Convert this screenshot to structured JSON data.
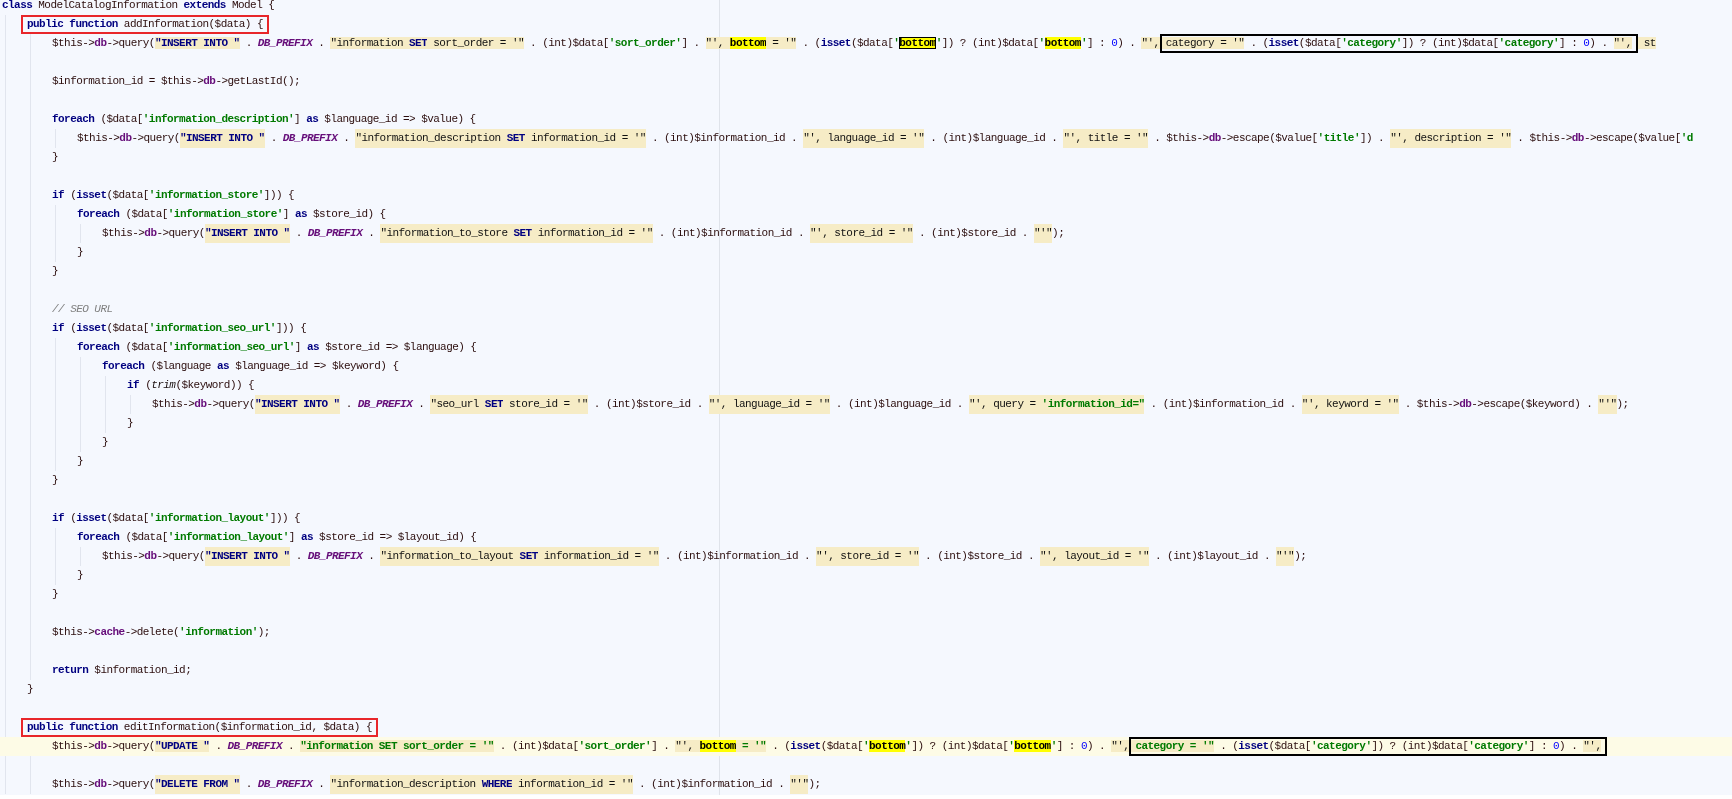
{
  "lines": [
    {
      "kind": "code",
      "current": false,
      "tokens": [
        {
          "kind": "kw",
          "text": "class"
        },
        {
          "kind": "code",
          "text": " ModelCatalogInformation "
        },
        {
          "kind": "kw",
          "text": "extends"
        },
        {
          "kind": "code",
          "text": " Model {"
        }
      ],
      "children": [
        {
          "kind": "code",
          "current": false,
          "tokens": [
            {
              "kind": "frame",
              "color": "#e8262a",
              "tokens": [
                {
                  "kind": "kw",
                  "text": "public function"
                },
                {
                  "kind": "code",
                  "text": " addInformation($data) {"
                }
              ]
            }
          ],
          "children": [
            {
              "kind": "code",
              "current": false,
              "tokens": [
                {
                  "kind": "code",
                  "text": "$this->"
                },
                {
                  "kind": "prop",
                  "text": "db"
                },
                {
                  "kind": "code",
                  "text": "->query("
                },
                {
                  "kind": "sqlkw",
                  "text": "\"INSERT INTO \""
                },
                {
                  "kind": "code",
                  "text": " . "
                },
                {
                  "kind": "const",
                  "text": "DB_PREFIX"
                },
                {
                  "kind": "code",
                  "text": " . "
                },
                {
                  "kind": "str",
                  "text": "\"information "
                },
                {
                  "kind": "sqlkw",
                  "text": "SET"
                },
                {
                  "kind": "str",
                  "text": " sort_order = '\""
                },
                {
                  "kind": "code",
                  "text": " . (int)$data["
                },
                {
                  "kind": "key",
                  "text": "'sort_order'"
                },
                {
                  "kind": "code",
                  "text": "] . "
                },
                {
                  "kind": "str",
                  "text": "\"', "
                },
                {
                  "kind": "mark",
                  "text": "bottom"
                },
                {
                  "kind": "str",
                  "text": " = '\""
                },
                {
                  "kind": "code",
                  "text": " . ("
                },
                {
                  "kind": "kw",
                  "text": "isset"
                },
                {
                  "kind": "code",
                  "text": "($data["
                },
                {
                  "kind": "key",
                  "text": "'"
                },
                {
                  "kind": "markcaret",
                  "text": "bottom"
                },
                {
                  "kind": "key",
                  "text": "'"
                },
                {
                  "kind": "code",
                  "text": "]) ? (int)$data["
                },
                {
                  "kind": "key",
                  "text": "'"
                },
                {
                  "kind": "mark",
                  "text": "bottom"
                },
                {
                  "kind": "key",
                  "text": "'"
                },
                {
                  "kind": "code",
                  "text": "] : "
                },
                {
                  "kind": "num",
                  "text": "0"
                },
                {
                  "kind": "code",
                  "text": ") . "
                },
                {
                  "kind": "str",
                  "text": "\"', "
                },
                {
                  "kind": "frame",
                  "color": "#000000",
                  "tokens": [
                    {
                      "kind": "str",
                      "text": "category = '\""
                    },
                    {
                      "kind": "code",
                      "text": " . ("
                    },
                    {
                      "kind": "kw",
                      "text": "isset"
                    },
                    {
                      "kind": "code",
                      "text": "($data["
                    },
                    {
                      "kind": "key",
                      "text": "'category'"
                    },
                    {
                      "kind": "code",
                      "text": "]) ? (int)$data["
                    },
                    {
                      "kind": "key",
                      "text": "'category'"
                    },
                    {
                      "kind": "code",
                      "text": "] : "
                    },
                    {
                      "kind": "num",
                      "text": "0"
                    },
                    {
                      "kind": "code",
                      "text": ") . "
                    },
                    {
                      "kind": "str",
                      "text": "\"',"
                    }
                  ]
                },
                {
                  "kind": "str",
                  "text": " st"
                }
              ]
            },
            {
              "kind": "blank",
              "current": false
            },
            {
              "kind": "code",
              "current": false,
              "tokens": [
                {
                  "kind": "code",
                  "text": "$information_id = $this->"
                },
                {
                  "kind": "prop",
                  "text": "db"
                },
                {
                  "kind": "code",
                  "text": "->getLastId();"
                }
              ]
            },
            {
              "kind": "blank",
              "current": false
            },
            {
              "kind": "code",
              "current": false,
              "tokens": [
                {
                  "kind": "kw",
                  "text": "foreach"
                },
                {
                  "kind": "code",
                  "text": " ($data["
                },
                {
                  "kind": "key",
                  "text": "'information_description'"
                },
                {
                  "kind": "code",
                  "text": "] "
                },
                {
                  "kind": "kw",
                  "text": "as"
                },
                {
                  "kind": "code",
                  "text": " $language_id => $value) {"
                }
              ],
              "children": [
                {
                  "kind": "code",
                  "current": false,
                  "tokens": [
                    {
                      "kind": "code",
                      "text": "$this->"
                    },
                    {
                      "kind": "prop",
                      "text": "db"
                    },
                    {
                      "kind": "code",
                      "text": "->query("
                    },
                    {
                      "kind": "sqlkw",
                      "text": "\"INSERT INTO \""
                    },
                    {
                      "kind": "code",
                      "text": " . "
                    },
                    {
                      "kind": "const",
                      "text": "DB_PREFIX"
                    },
                    {
                      "kind": "code",
                      "text": " . "
                    },
                    {
                      "kind": "str",
                      "text": "\"information_description "
                    },
                    {
                      "kind": "sqlkw",
                      "text": "SET"
                    },
                    {
                      "kind": "str",
                      "text": " information_id = '\""
                    },
                    {
                      "kind": "code",
                      "text": " . (int)$information_id . "
                    },
                    {
                      "kind": "str",
                      "text": "\"', language_id = '\""
                    },
                    {
                      "kind": "code",
                      "text": " . (int)$language_id . "
                    },
                    {
                      "kind": "str",
                      "text": "\"', title = '\""
                    },
                    {
                      "kind": "code",
                      "text": " . $this->"
                    },
                    {
                      "kind": "prop",
                      "text": "db"
                    },
                    {
                      "kind": "code",
                      "text": "->escape($value["
                    },
                    {
                      "kind": "key",
                      "text": "'title'"
                    },
                    {
                      "kind": "code",
                      "text": "]) . "
                    },
                    {
                      "kind": "str",
                      "text": "\"', description = '\""
                    },
                    {
                      "kind": "code",
                      "text": " . $this->"
                    },
                    {
                      "kind": "prop",
                      "text": "db"
                    },
                    {
                      "kind": "code",
                      "text": "->escape($value["
                    },
                    {
                      "kind": "key",
                      "text": "'d"
                    }
                  ]
                }
              ]
            },
            {
              "kind": "code",
              "current": false,
              "tokens": [
                {
                  "kind": "code",
                  "text": "}"
                }
              ]
            },
            {
              "kind": "blank",
              "current": false
            },
            {
              "kind": "code",
              "current": false,
              "tokens": [
                {
                  "kind": "kw",
                  "text": "if"
                },
                {
                  "kind": "code",
                  "text": " ("
                },
                {
                  "kind": "kw",
                  "text": "isset"
                },
                {
                  "kind": "code",
                  "text": "($data["
                },
                {
                  "kind": "key",
                  "text": "'information_store'"
                },
                {
                  "kind": "code",
                  "text": "])) {"
                }
              ],
              "children": [
                {
                  "kind": "code",
                  "current": false,
                  "tokens": [
                    {
                      "kind": "kw",
                      "text": "foreach"
                    },
                    {
                      "kind": "code",
                      "text": " ($data["
                    },
                    {
                      "kind": "key",
                      "text": "'information_store'"
                    },
                    {
                      "kind": "code",
                      "text": "] "
                    },
                    {
                      "kind": "kw",
                      "text": "as"
                    },
                    {
                      "kind": "code",
                      "text": " $store_id) {"
                    }
                  ],
                  "children": [
                    {
                      "kind": "code",
                      "current": false,
                      "tokens": [
                        {
                          "kind": "code",
                          "text": "$this->"
                        },
                        {
                          "kind": "prop",
                          "text": "db"
                        },
                        {
                          "kind": "code",
                          "text": "->query("
                        },
                        {
                          "kind": "sqlkw",
                          "text": "\"INSERT INTO \""
                        },
                        {
                          "kind": "code",
                          "text": " . "
                        },
                        {
                          "kind": "const",
                          "text": "DB_PREFIX"
                        },
                        {
                          "kind": "code",
                          "text": " . "
                        },
                        {
                          "kind": "str",
                          "text": "\"information_to_store "
                        },
                        {
                          "kind": "sqlkw",
                          "text": "SET"
                        },
                        {
                          "kind": "str",
                          "text": " information_id = '\""
                        },
                        {
                          "kind": "code",
                          "text": " . (int)$information_id . "
                        },
                        {
                          "kind": "str",
                          "text": "\"', store_id = '\""
                        },
                        {
                          "kind": "code",
                          "text": " . (int)$store_id . "
                        },
                        {
                          "kind": "str",
                          "text": "\"'\""
                        },
                        {
                          "kind": "code",
                          "text": ");"
                        }
                      ]
                    }
                  ]
                },
                {
                  "kind": "code",
                  "current": false,
                  "tokens": [
                    {
                      "kind": "code",
                      "text": "}"
                    }
                  ]
                }
              ]
            },
            {
              "kind": "code",
              "current": false,
              "tokens": [
                {
                  "kind": "code",
                  "text": "}"
                }
              ]
            },
            {
              "kind": "blank",
              "current": false
            },
            {
              "kind": "code",
              "current": false,
              "tokens": [
                {
                  "kind": "comment",
                  "text": "// SEO URL"
                }
              ]
            },
            {
              "kind": "code",
              "current": false,
              "tokens": [
                {
                  "kind": "kw",
                  "text": "if"
                },
                {
                  "kind": "code",
                  "text": " ("
                },
                {
                  "kind": "kw",
                  "text": "isset"
                },
                {
                  "kind": "code",
                  "text": "($data["
                },
                {
                  "kind": "key",
                  "text": "'information_seo_url'"
                },
                {
                  "kind": "code",
                  "text": "])) {"
                }
              ],
              "children": [
                {
                  "kind": "code",
                  "current": false,
                  "tokens": [
                    {
                      "kind": "kw",
                      "text": "foreach"
                    },
                    {
                      "kind": "code",
                      "text": " ($data["
                    },
                    {
                      "kind": "key",
                      "text": "'information_seo_url'"
                    },
                    {
                      "kind": "code",
                      "text": "] "
                    },
                    {
                      "kind": "kw",
                      "text": "as"
                    },
                    {
                      "kind": "code",
                      "text": " $store_id => $language) {"
                    }
                  ],
                  "children": [
                    {
                      "kind": "code",
                      "current": false,
                      "tokens": [
                        {
                          "kind": "kw",
                          "text": "foreach"
                        },
                        {
                          "kind": "code",
                          "text": " ($language "
                        },
                        {
                          "kind": "kw",
                          "text": "as"
                        },
                        {
                          "kind": "code",
                          "text": " $language_id => $keyword) {"
                        }
                      ],
                      "children": [
                        {
                          "kind": "code",
                          "current": false,
                          "tokens": [
                            {
                              "kind": "kw",
                              "text": "if"
                            },
                            {
                              "kind": "code",
                              "text": " ("
                            },
                            {
                              "kind": "fn",
                              "text": "trim"
                            },
                            {
                              "kind": "code",
                              "text": "($keyword)) {"
                            }
                          ],
                          "children": [
                            {
                              "kind": "code",
                              "current": false,
                              "tokens": [
                                {
                                  "kind": "code",
                                  "text": "$this->"
                                },
                                {
                                  "kind": "prop",
                                  "text": "db"
                                },
                                {
                                  "kind": "code",
                                  "text": "->query("
                                },
                                {
                                  "kind": "sqlkw",
                                  "text": "\"INSERT INTO \""
                                },
                                {
                                  "kind": "code",
                                  "text": " . "
                                },
                                {
                                  "kind": "const",
                                  "text": "DB_PREFIX"
                                },
                                {
                                  "kind": "code",
                                  "text": " . "
                                },
                                {
                                  "kind": "str",
                                  "text": "\"seo_url "
                                },
                                {
                                  "kind": "sqlkw",
                                  "text": "SET"
                                },
                                {
                                  "kind": "str",
                                  "text": " store_id = '\""
                                },
                                {
                                  "kind": "code",
                                  "text": " . (int)$store_id . "
                                },
                                {
                                  "kind": "str",
                                  "text": "\"', language_id = '\""
                                },
                                {
                                  "kind": "code",
                                  "text": " . (int)$language_id . "
                                },
                                {
                                  "kind": "str",
                                  "text": "\"', query = "
                                },
                                {
                                  "kind": "sqlstr",
                                  "text": "'information_id=\""
                                },
                                {
                                  "kind": "code",
                                  "text": " . (int)$information_id . "
                                },
                                {
                                  "kind": "str",
                                  "text": "\"', keyword = '\""
                                },
                                {
                                  "kind": "code",
                                  "text": " . $this->"
                                },
                                {
                                  "kind": "prop",
                                  "text": "db"
                                },
                                {
                                  "kind": "code",
                                  "text": "->escape($keyword) . "
                                },
                                {
                                  "kind": "str",
                                  "text": "\"'\""
                                },
                                {
                                  "kind": "code",
                                  "text": ");"
                                }
                              ]
                            }
                          ]
                        },
                        {
                          "kind": "code",
                          "current": false,
                          "tokens": [
                            {
                              "kind": "code",
                              "text": "}"
                            }
                          ]
                        }
                      ]
                    },
                    {
                      "kind": "code",
                      "current": false,
                      "tokens": [
                        {
                          "kind": "code",
                          "text": "}"
                        }
                      ]
                    }
                  ]
                },
                {
                  "kind": "code",
                  "current": false,
                  "tokens": [
                    {
                      "kind": "code",
                      "text": "}"
                    }
                  ]
                }
              ]
            },
            {
              "kind": "code",
              "current": false,
              "tokens": [
                {
                  "kind": "code",
                  "text": "}"
                }
              ]
            },
            {
              "kind": "blank",
              "current": false
            },
            {
              "kind": "code",
              "current": false,
              "tokens": [
                {
                  "kind": "kw",
                  "text": "if"
                },
                {
                  "kind": "code",
                  "text": " ("
                },
                {
                  "kind": "kw",
                  "text": "isset"
                },
                {
                  "kind": "code",
                  "text": "($data["
                },
                {
                  "kind": "key",
                  "text": "'information_layout'"
                },
                {
                  "kind": "code",
                  "text": "])) {"
                }
              ],
              "children": [
                {
                  "kind": "code",
                  "current": false,
                  "tokens": [
                    {
                      "kind": "kw",
                      "text": "foreach"
                    },
                    {
                      "kind": "code",
                      "text": " ($data["
                    },
                    {
                      "kind": "key",
                      "text": "'information_layout'"
                    },
                    {
                      "kind": "code",
                      "text": "] "
                    },
                    {
                      "kind": "kw",
                      "text": "as"
                    },
                    {
                      "kind": "code",
                      "text": " $store_id => $layout_id) {"
                    }
                  ],
                  "children": [
                    {
                      "kind": "code",
                      "current": false,
                      "tokens": [
                        {
                          "kind": "code",
                          "text": "$this->"
                        },
                        {
                          "kind": "prop",
                          "text": "db"
                        },
                        {
                          "kind": "code",
                          "text": "->query("
                        },
                        {
                          "kind": "sqlkw",
                          "text": "\"INSERT INTO \""
                        },
                        {
                          "kind": "code",
                          "text": " . "
                        },
                        {
                          "kind": "const",
                          "text": "DB_PREFIX"
                        },
                        {
                          "kind": "code",
                          "text": " . "
                        },
                        {
                          "kind": "str",
                          "text": "\"information_to_layout "
                        },
                        {
                          "kind": "sqlkw",
                          "text": "SET"
                        },
                        {
                          "kind": "str",
                          "text": " information_id = '\""
                        },
                        {
                          "kind": "code",
                          "text": " . (int)$information_id . "
                        },
                        {
                          "kind": "str",
                          "text": "\"', store_id = '\""
                        },
                        {
                          "kind": "code",
                          "text": " . (int)$store_id . "
                        },
                        {
                          "kind": "str",
                          "text": "\"', layout_id = '\""
                        },
                        {
                          "kind": "code",
                          "text": " . (int)$layout_id . "
                        },
                        {
                          "kind": "str",
                          "text": "\"'\""
                        },
                        {
                          "kind": "code",
                          "text": ");"
                        }
                      ]
                    }
                  ]
                },
                {
                  "kind": "code",
                  "current": false,
                  "tokens": [
                    {
                      "kind": "code",
                      "text": "}"
                    }
                  ]
                }
              ]
            },
            {
              "kind": "code",
              "current": false,
              "tokens": [
                {
                  "kind": "code",
                  "text": "}"
                }
              ]
            },
            {
              "kind": "blank",
              "current": false
            },
            {
              "kind": "code",
              "current": false,
              "tokens": [
                {
                  "kind": "code",
                  "text": "$this->"
                },
                {
                  "kind": "prop",
                  "text": "cache"
                },
                {
                  "kind": "code",
                  "text": "->delete("
                },
                {
                  "kind": "key",
                  "text": "'information'"
                },
                {
                  "kind": "code",
                  "text": ");"
                }
              ]
            },
            {
              "kind": "blank",
              "current": false
            },
            {
              "kind": "code",
              "current": false,
              "tokens": [
                {
                  "kind": "kw",
                  "text": "return"
                },
                {
                  "kind": "code",
                  "text": " $information_id;"
                }
              ]
            }
          ]
        },
        {
          "kind": "code",
          "current": false,
          "tokens": [
            {
              "kind": "code",
              "text": "}"
            }
          ]
        },
        {
          "kind": "blank",
          "current": false
        },
        {
          "kind": "code",
          "current": false,
          "tokens": [
            {
              "kind": "frame",
              "color": "#e8262a",
              "tokens": [
                {
                  "kind": "kw",
                  "text": "public function"
                },
                {
                  "kind": "code",
                  "text": " editInformation($information_id, $data) {"
                }
              ]
            }
          ],
          "children": [
            {
              "kind": "code",
              "current": true,
              "tokens": [
                {
                  "kind": "code",
                  "text": "$this->"
                },
                {
                  "kind": "prop",
                  "text": "db"
                },
                {
                  "kind": "code",
                  "text": "->query("
                },
                {
                  "kind": "sqlkw",
                  "text": "\"UPDATE \""
                },
                {
                  "kind": "code",
                  "text": " . "
                },
                {
                  "kind": "const",
                  "text": "DB_PREFIX"
                },
                {
                  "kind": "code",
                  "text": " . "
                },
                {
                  "kind": "sqlstr",
                  "text": "\"information SET sort_order = '\""
                },
                {
                  "kind": "code",
                  "text": " . (int)$data["
                },
                {
                  "kind": "key",
                  "text": "'sort_order'"
                },
                {
                  "kind": "code",
                  "text": "] . "
                },
                {
                  "kind": "str",
                  "text": "\"', "
                },
                {
                  "kind": "mark",
                  "text": "bottom"
                },
                {
                  "kind": "sqlstr",
                  "text": " = '\""
                },
                {
                  "kind": "code",
                  "text": " . ("
                },
                {
                  "kind": "kw",
                  "text": "isset"
                },
                {
                  "kind": "code",
                  "text": "($data["
                },
                {
                  "kind": "key",
                  "text": "'"
                },
                {
                  "kind": "mark",
                  "text": "bottom"
                },
                {
                  "kind": "key",
                  "text": "'"
                },
                {
                  "kind": "code",
                  "text": "]) ? (int)$data["
                },
                {
                  "kind": "key",
                  "text": "'"
                },
                {
                  "kind": "mark",
                  "text": "bottom"
                },
                {
                  "kind": "key",
                  "text": "'"
                },
                {
                  "kind": "code",
                  "text": "] : "
                },
                {
                  "kind": "num",
                  "text": "0"
                },
                {
                  "kind": "code",
                  "text": ") . "
                },
                {
                  "kind": "str",
                  "text": "\"', "
                },
                {
                  "kind": "frame",
                  "color": "#000000",
                  "tokens": [
                    {
                      "kind": "sqlstr",
                      "text": "category = '\""
                    },
                    {
                      "kind": "code",
                      "text": " . ("
                    },
                    {
                      "kind": "kw",
                      "text": "isset"
                    },
                    {
                      "kind": "code",
                      "text": "($data["
                    },
                    {
                      "kind": "key",
                      "text": "'category'"
                    },
                    {
                      "kind": "code",
                      "text": "]) ? (int)$data["
                    },
                    {
                      "kind": "key",
                      "text": "'category'"
                    },
                    {
                      "kind": "code",
                      "text": "] : "
                    },
                    {
                      "kind": "num",
                      "text": "0"
                    },
                    {
                      "kind": "code",
                      "text": ") . "
                    },
                    {
                      "kind": "str",
                      "text": "\"',"
                    }
                  ]
                }
              ]
            },
            {
              "kind": "blank",
              "current": false
            },
            {
              "kind": "code",
              "current": false,
              "tokens": [
                {
                  "kind": "code",
                  "text": "$this->"
                },
                {
                  "kind": "prop",
                  "text": "db"
                },
                {
                  "kind": "code",
                  "text": "->query("
                },
                {
                  "kind": "sqlkw",
                  "text": "\"DELETE FROM \""
                },
                {
                  "kind": "code",
                  "text": " . "
                },
                {
                  "kind": "const",
                  "text": "DB_PREFIX"
                },
                {
                  "kind": "code",
                  "text": " . "
                },
                {
                  "kind": "str",
                  "text": "\"information_description "
                },
                {
                  "kind": "sqlkw",
                  "text": "WHERE"
                },
                {
                  "kind": "str",
                  "text": " information_id = '\""
                },
                {
                  "kind": "code",
                  "text": " . (int)$information_id . "
                },
                {
                  "kind": "str",
                  "text": "\"'\""
                },
                {
                  "kind": "code",
                  "text": ");"
                }
              ]
            }
          ]
        }
      ]
    }
  ]
}
